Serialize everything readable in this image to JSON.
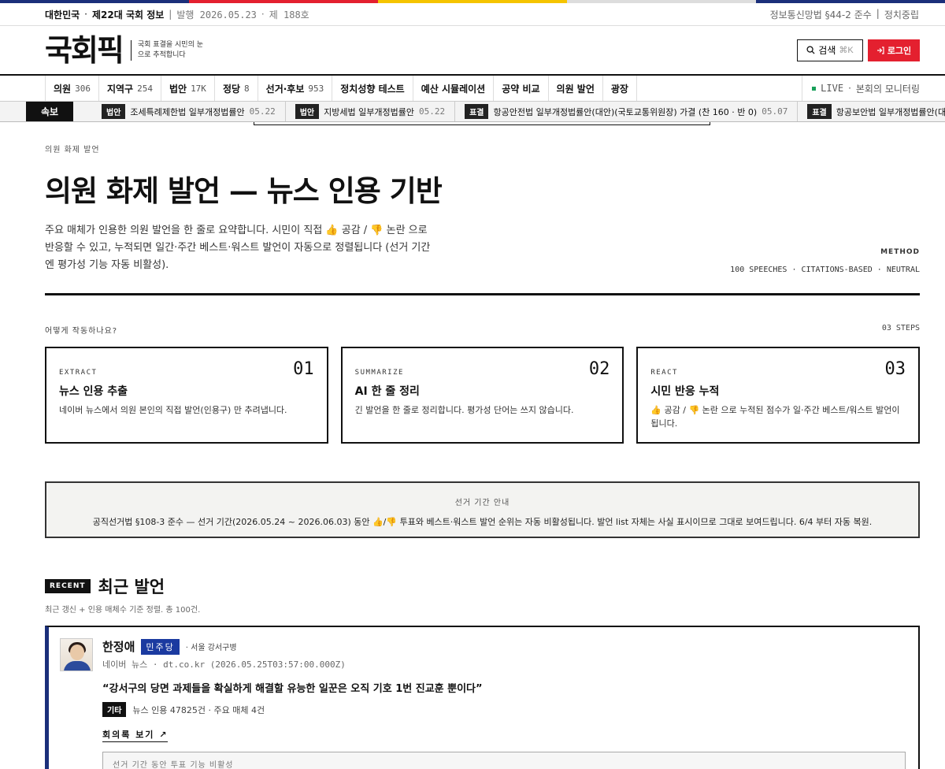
{
  "topbar": {
    "country": "대한민국",
    "assembly": "제22대 국회 정보",
    "issue_date": "발행 2026.05.23",
    "issue_no": "제 188호",
    "law": "정보통신망법 §44-2 준수",
    "neutral": "정치중립"
  },
  "masthead": {
    "logo": "국회픽",
    "tagline": "국회 표결을 시민의 눈으로 추적합니다",
    "search_label": "검색",
    "search_shortcut": "⌘K",
    "login_label": "로그인"
  },
  "nav": {
    "items": [
      {
        "label": "의원",
        "count": "306"
      },
      {
        "label": "지역구",
        "count": "254"
      },
      {
        "label": "법안",
        "count": "17K"
      },
      {
        "label": "정당",
        "count": "8"
      },
      {
        "label": "선거·후보",
        "count": "953"
      },
      {
        "label": "정치성향 테스트",
        "count": ""
      },
      {
        "label": "예산 시뮬레이션",
        "count": ""
      },
      {
        "label": "공약 비교",
        "count": ""
      },
      {
        "label": "의원 발언",
        "count": ""
      },
      {
        "label": "광장",
        "count": ""
      }
    ],
    "live_label": "LIVE",
    "live_text": "본회의 모니터링"
  },
  "ticker": {
    "label": "속보",
    "items": [
      {
        "tag": "법안",
        "text": "조세특례제한법 일부개정법률안",
        "date": "05.22"
      },
      {
        "tag": "법안",
        "text": "지방세법 일부개정법률안",
        "date": "05.22"
      },
      {
        "tag": "표결",
        "text": "항공안전법 일부개정법률안(대안)(국토교통위원장) 가결 (찬 160 · 반 0)",
        "date": "05.07"
      },
      {
        "tag": "표결",
        "text": "항공보안법 일부개정법률안(대안)(국토교",
        "date": ""
      }
    ]
  },
  "hero": {
    "eyebrow": "의원 화제 발언",
    "title": "의원 화제 발언 — 뉴스 인용 기반",
    "desc": "주요 매체가 인용한 의원 발언을 한 줄로 요약합니다. 시민이 직접 👍 공감 / 👎 논란 으로 반응할 수 있고, 누적되면 일간·주간 베스트·워스트 발언이 자동으로 정렬됩니다 (선거 기간엔 평가성 기능 자동 비활성).",
    "method_label": "METHOD",
    "method_value": "100 SPEECHES · CITATIONS-BASED · NEUTRAL"
  },
  "how": {
    "title": "어떻게 작동하나요?",
    "count": "03 STEPS",
    "steps": [
      {
        "key": "EXTRACT",
        "num": "01",
        "title": "뉴스 인용 추출",
        "desc": "네이버 뉴스에서 의원 본인의 직접 발언(인용구) 만 추려냅니다."
      },
      {
        "key": "SUMMARIZE",
        "num": "02",
        "title": "AI 한 줄 정리",
        "desc": "긴 발언을 한 줄로 정리합니다. 평가성 단어는 쓰지 않습니다."
      },
      {
        "key": "REACT",
        "num": "03",
        "title": "시민 반응 누적",
        "desc": "👍 공감 / 👎 논란 으로 누적된 점수가 일·주간 베스트/워스트 발언이 됩니다."
      }
    ]
  },
  "notice": {
    "title": "선거 기간 안내",
    "body": "공직선거법 §108-3 준수 — 선거 기간(2026.05.24 ~ 2026.06.03) 동안 👍/👎 투표와 베스트·워스트 발언 순위는 자동 비활성됩니다. 발언 list 자체는 사실 표시이므로 그대로 보여드립니다. 6/4 부터 자동 복원."
  },
  "recent": {
    "badge": "RECENT",
    "title": "최근 발언",
    "subtitle": "최근 갱신 + 인용 매체수 기준 정렬. 총 100건.",
    "card": {
      "name": "한정애",
      "party": "민주당",
      "region": "· 서울 강서구병",
      "source": "네이버 뉴스 · dt.co.kr (2026.05.25T03:57:00.000Z)",
      "quote": "“강서구의 당면 과제들을 확실하게 해결할 유능한 일꾼은 오직 기호 1번 진교훈 뿐이다”",
      "category": "기타",
      "stats": "뉴스 인용 47825건 · 주요 매체 4건",
      "link": "회의록 보기 ↗",
      "vote_disabled": "선거 기간 동안 투표 기능 비활성"
    }
  },
  "colors": {
    "stripe": [
      "#1b2f7a",
      "#e4202f",
      "#f5c400",
      "#ffffff",
      "#1b2f7a"
    ],
    "accent": "#e4202f",
    "party": "#1b3aa0"
  }
}
